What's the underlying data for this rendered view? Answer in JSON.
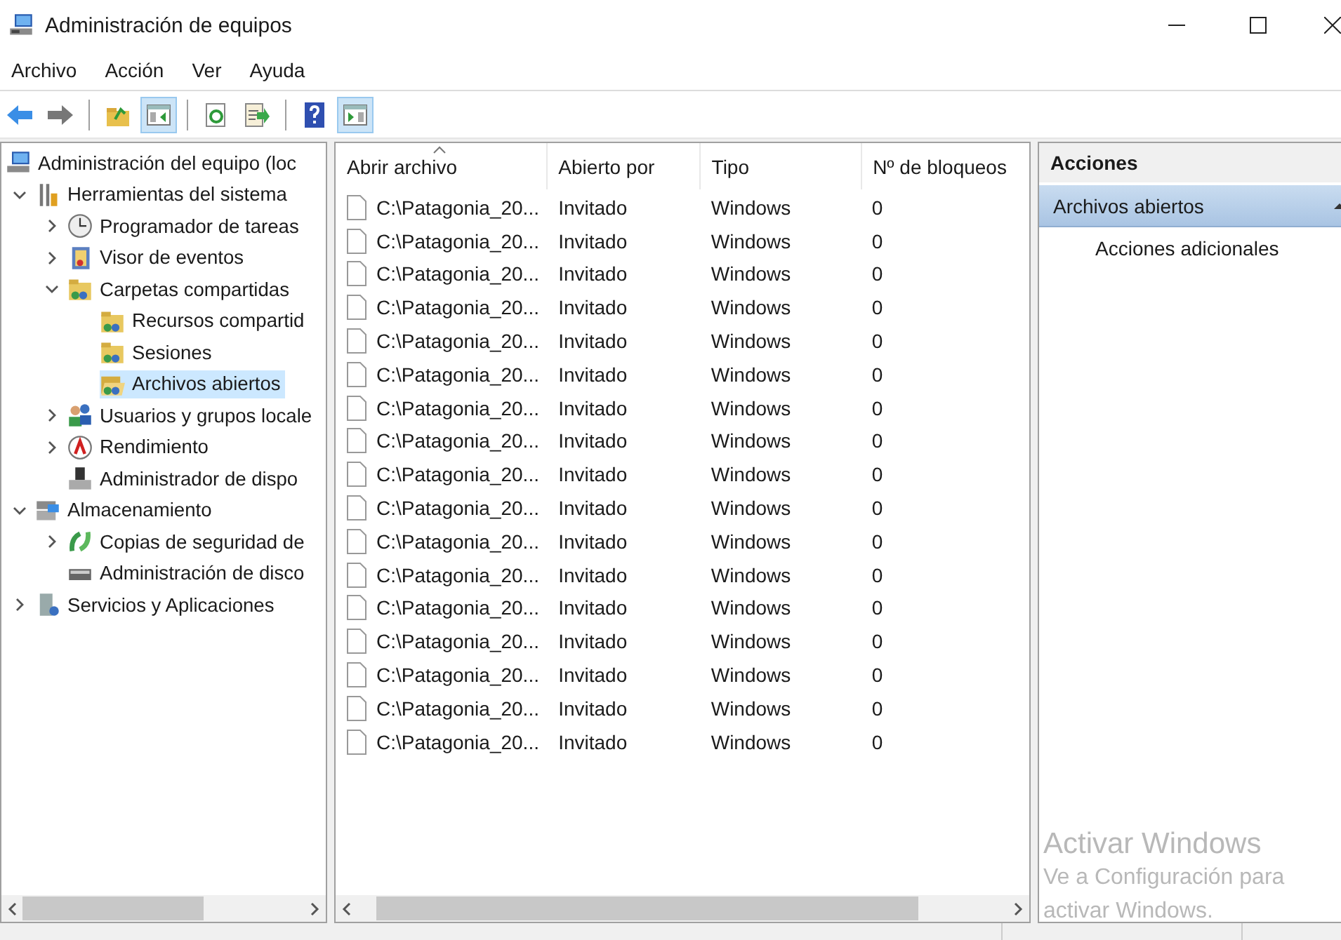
{
  "window": {
    "title": "Administración de equipos"
  },
  "menu": [
    "Archivo",
    "Acción",
    "Ver",
    "Ayuda"
  ],
  "toolbar": [
    {
      "kind": "back",
      "pressed": false
    },
    {
      "kind": "forward",
      "pressed": false
    },
    {
      "kind": "separator"
    },
    {
      "kind": "up",
      "pressed": false
    },
    {
      "kind": "tree",
      "pressed": true
    },
    {
      "kind": "separator"
    },
    {
      "kind": "refresh",
      "pressed": false
    },
    {
      "kind": "export",
      "pressed": false
    },
    {
      "kind": "separator"
    },
    {
      "kind": "help",
      "pressed": false
    },
    {
      "kind": "actionpane",
      "pressed": true
    }
  ],
  "tree": {
    "label": "Administración del equipo (loc",
    "kind": "computer",
    "selected": false,
    "children": [
      {
        "label": "Herramientas del sistema",
        "kind": "tools",
        "expanded": true,
        "selected": false,
        "children": [
          {
            "label": "Programador de tareas",
            "kind": "clock",
            "expanded": false,
            "selected": false
          },
          {
            "label": "Visor de eventos",
            "kind": "events",
            "expanded": false,
            "selected": false
          },
          {
            "label": "Carpetas compartidas",
            "kind": "share",
            "expanded": true,
            "selected": false,
            "children": [
              {
                "label": "Recursos compartid",
                "kind": "share",
                "selected": false
              },
              {
                "label": "Sesiones",
                "kind": "share",
                "selected": false
              },
              {
                "label": "Archivos abiertos",
                "kind": "openshare",
                "selected": true
              }
            ]
          },
          {
            "label": "Usuarios y grupos locale",
            "kind": "users",
            "expanded": false,
            "selected": false
          },
          {
            "label": "Rendimiento",
            "kind": "performance",
            "expanded": false,
            "selected": false
          },
          {
            "label": "Administrador de dispo",
            "kind": "device",
            "selected": false
          }
        ]
      },
      {
        "label": "Almacenamiento",
        "kind": "storage",
        "expanded": true,
        "selected": false,
        "children": [
          {
            "label": "Copias de seguridad de",
            "kind": "backup",
            "expanded": false,
            "selected": false
          },
          {
            "label": "Administración de disco",
            "kind": "disk",
            "selected": false
          }
        ]
      },
      {
        "label": "Servicios y Aplicaciones",
        "kind": "services",
        "expanded": false,
        "selected": false
      }
    ]
  },
  "table": {
    "columns": [
      {
        "label": "Abrir archivo",
        "sorted": true
      },
      {
        "label": "Abierto por",
        "sorted": false
      },
      {
        "label": "Tipo",
        "sorted": false
      },
      {
        "label": "Nº de bloqueos",
        "sorted": false
      }
    ],
    "rows": [
      {
        "file": "C:\\Patagonia_20...",
        "opened_by": "Invitado",
        "type": "Windows",
        "locks": "0"
      },
      {
        "file": "C:\\Patagonia_20...",
        "opened_by": "Invitado",
        "type": "Windows",
        "locks": "0"
      },
      {
        "file": "C:\\Patagonia_20...",
        "opened_by": "Invitado",
        "type": "Windows",
        "locks": "0"
      },
      {
        "file": "C:\\Patagonia_20...",
        "opened_by": "Invitado",
        "type": "Windows",
        "locks": "0"
      },
      {
        "file": "C:\\Patagonia_20...",
        "opened_by": "Invitado",
        "type": "Windows",
        "locks": "0"
      },
      {
        "file": "C:\\Patagonia_20...",
        "opened_by": "Invitado",
        "type": "Windows",
        "locks": "0"
      },
      {
        "file": "C:\\Patagonia_20...",
        "opened_by": "Invitado",
        "type": "Windows",
        "locks": "0"
      },
      {
        "file": "C:\\Patagonia_20...",
        "opened_by": "Invitado",
        "type": "Windows",
        "locks": "0"
      },
      {
        "file": "C:\\Patagonia_20...",
        "opened_by": "Invitado",
        "type": "Windows",
        "locks": "0"
      },
      {
        "file": "C:\\Patagonia_20...",
        "opened_by": "Invitado",
        "type": "Windows",
        "locks": "0"
      },
      {
        "file": "C:\\Patagonia_20...",
        "opened_by": "Invitado",
        "type": "Windows",
        "locks": "0"
      },
      {
        "file": "C:\\Patagonia_20...",
        "opened_by": "Invitado",
        "type": "Windows",
        "locks": "0"
      },
      {
        "file": "C:\\Patagonia_20...",
        "opened_by": "Invitado",
        "type": "Windows",
        "locks": "0"
      },
      {
        "file": "C:\\Patagonia_20...",
        "opened_by": "Invitado",
        "type": "Windows",
        "locks": "0"
      },
      {
        "file": "C:\\Patagonia_20...",
        "opened_by": "Invitado",
        "type": "Windows",
        "locks": "0"
      },
      {
        "file": "C:\\Patagonia_20...",
        "opened_by": "Invitado",
        "type": "Windows",
        "locks": "0"
      },
      {
        "file": "C:\\Patagonia_20...",
        "opened_by": "Invitado",
        "type": "Windows",
        "locks": "0"
      }
    ]
  },
  "actions": {
    "title": "Acciones",
    "sections": [
      {
        "label": "Archivos abiertos",
        "expanded": true,
        "items": [
          "Acciones adicionales"
        ]
      }
    ]
  },
  "activation_notice": {
    "title": "Activar Windows",
    "text": "Ve a Configuración para activar Windows."
  }
}
